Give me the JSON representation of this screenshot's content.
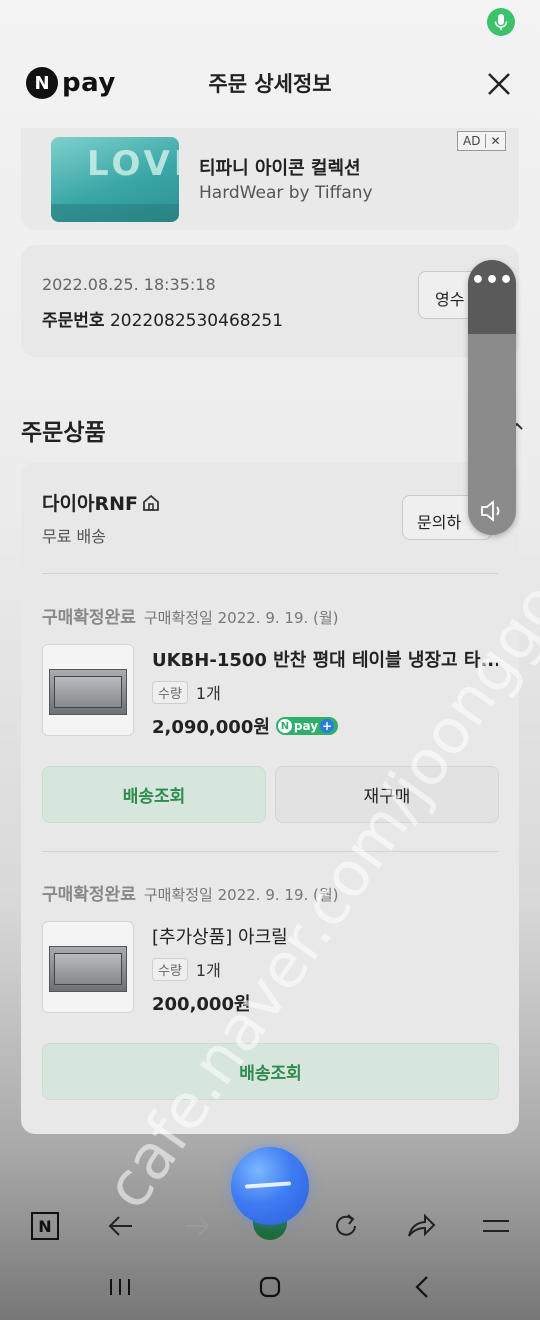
{
  "header": {
    "logo_n": "N",
    "logo_pay": "pay",
    "title": "주문 상세정보"
  },
  "ad": {
    "thumb_text": "LOVE",
    "title": "티파니 아이콘 컬렉션",
    "subtitle": "HardWear by Tiffany",
    "badge": "AD"
  },
  "order": {
    "datetime": "2022.08.25. 18:35:18",
    "number_label": "주문번호",
    "number": "2022082530468251",
    "receipt_button": "영수"
  },
  "products_section": {
    "title": "주문상품",
    "seller": "다이아RNF",
    "shipping": "무료 배송",
    "inquiry_button": "문의하",
    "items": [
      {
        "status": "구매확정완료",
        "status_date": "구매확정일 2022. 9. 19. (월)",
        "name": "UKBH-1500 반찬 평대 테이블 냉장고 타...",
        "qty_label": "수량",
        "qty": "1개",
        "price": "2,090,000원",
        "npay_badge": "pay",
        "buttons": [
          "배송조회",
          "재구매"
        ]
      },
      {
        "status": "구매확정완료",
        "status_date": "구매확정일 2022. 9. 19. (월)",
        "name": "[추가상품] 아크릴",
        "qty_label": "수량",
        "qty": "1개",
        "price": "200,000원",
        "buttons": [
          "배송조회"
        ]
      }
    ]
  },
  "volume_panel": {
    "menu": "•••"
  },
  "watermark": "cafe.naver.com/joonggonara",
  "browser_bar": {
    "icons": [
      "naver-n-icon",
      "back-arrow-icon",
      "forward-arrow-icon",
      "home-icon",
      "refresh-icon",
      "share-icon",
      "menu-icon"
    ],
    "n_label": "N"
  },
  "colors": {
    "accent_green": "#2e8a4e",
    "npay_green": "#2fb06a",
    "assistant_blue": "#3f7cf3"
  }
}
